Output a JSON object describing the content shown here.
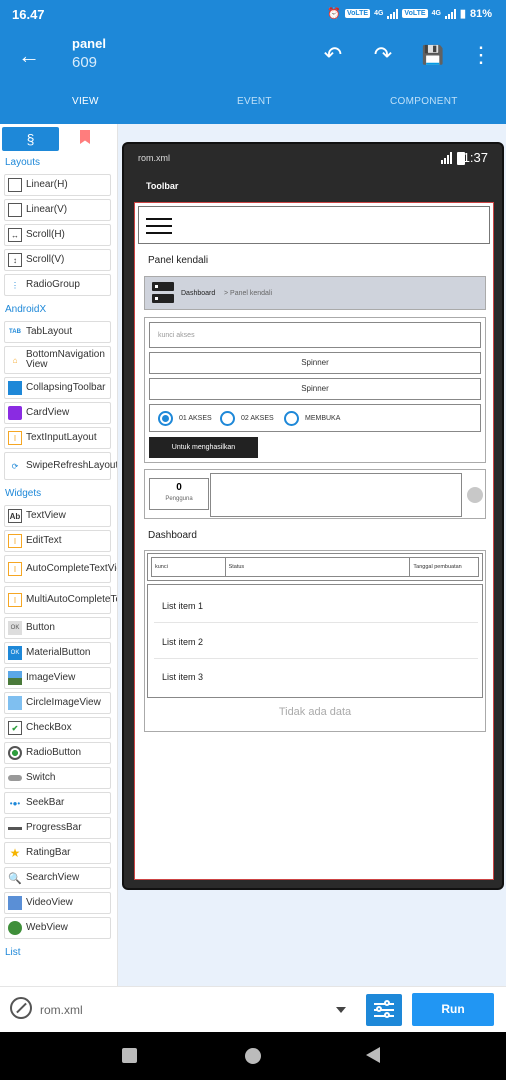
{
  "status_bar": {
    "time": "16.47",
    "net1": "VoLTE",
    "net2": "VoLTE",
    "lte": "4G",
    "battery": "81%"
  },
  "toolbar": {
    "title": "panel",
    "subtitle": "609"
  },
  "tabs": [
    {
      "label": "VIEW"
    },
    {
      "label": "EVENT"
    },
    {
      "label": "COMPONENT"
    }
  ],
  "palette": {
    "layouts_title": "Layouts",
    "layouts": [
      {
        "label": "Linear(H)"
      },
      {
        "label": "Linear(V)"
      },
      {
        "label": "Scroll(H)"
      },
      {
        "label": "Scroll(V)"
      },
      {
        "label": "RadioGroup"
      }
    ],
    "androidx_title": "AndroidX",
    "androidx": [
      {
        "label": "TabLayout",
        "icon": "TAB"
      },
      {
        "label": "BottomNavigation View"
      },
      {
        "label": "CollapsingToolbar"
      },
      {
        "label": "CardView"
      },
      {
        "label": "TextInputLayout"
      },
      {
        "label": "SwipeRefreshLayout"
      }
    ],
    "widgets_title": "Widgets",
    "widgets": [
      {
        "label": "TextView",
        "icon": "Ab"
      },
      {
        "label": "EditText"
      },
      {
        "label": "AutoCompleteTextView"
      },
      {
        "label": "MultiAutoCompleteTextView"
      },
      {
        "label": "Button",
        "icon": "OK"
      },
      {
        "label": "MaterialButton",
        "icon": "OK"
      },
      {
        "label": "ImageView"
      },
      {
        "label": "CircleImageView"
      },
      {
        "label": "CheckBox"
      },
      {
        "label": "RadioButton"
      },
      {
        "label": "Switch"
      },
      {
        "label": "SeekBar"
      },
      {
        "label": "ProgressBar"
      },
      {
        "label": "RatingBar"
      },
      {
        "label": "SearchView"
      },
      {
        "label": "VideoView"
      },
      {
        "label": "WebView"
      }
    ],
    "list_title": "List"
  },
  "device": {
    "file_name": "rom.xml",
    "time": "1:37",
    "toolbar_label": "Toolbar",
    "panel_title": "Panel kendali",
    "breadcrumb": {
      "home": "Dashboard",
      "current": "> Panel kendali"
    },
    "input_placeholder": "kunci akses",
    "spinner1": "Spinner",
    "spinner2": "Spinner",
    "radio": [
      {
        "label": "01 AKSES",
        "checked": true
      },
      {
        "label": "02 AKSES",
        "checked": false
      },
      {
        "label": "MEMBUKA",
        "checked": false
      }
    ],
    "action_button": "Untuk menghasilkan",
    "counter": {
      "value": "0",
      "label": "Pengguna"
    },
    "dashboard_title": "Dashboard",
    "table_headers": [
      "kunci",
      "Status",
      "Tanggal pembuatan"
    ],
    "list_items": [
      "List item 1",
      "List item 2",
      "List item 3"
    ],
    "empty_text": "Tidak ada data"
  },
  "bottom_bar": {
    "file": "rom.xml",
    "run_label": "Run"
  },
  "colors": {
    "primary": "#1e88d8",
    "accent": "#ffd200",
    "run": "#2196f3"
  }
}
